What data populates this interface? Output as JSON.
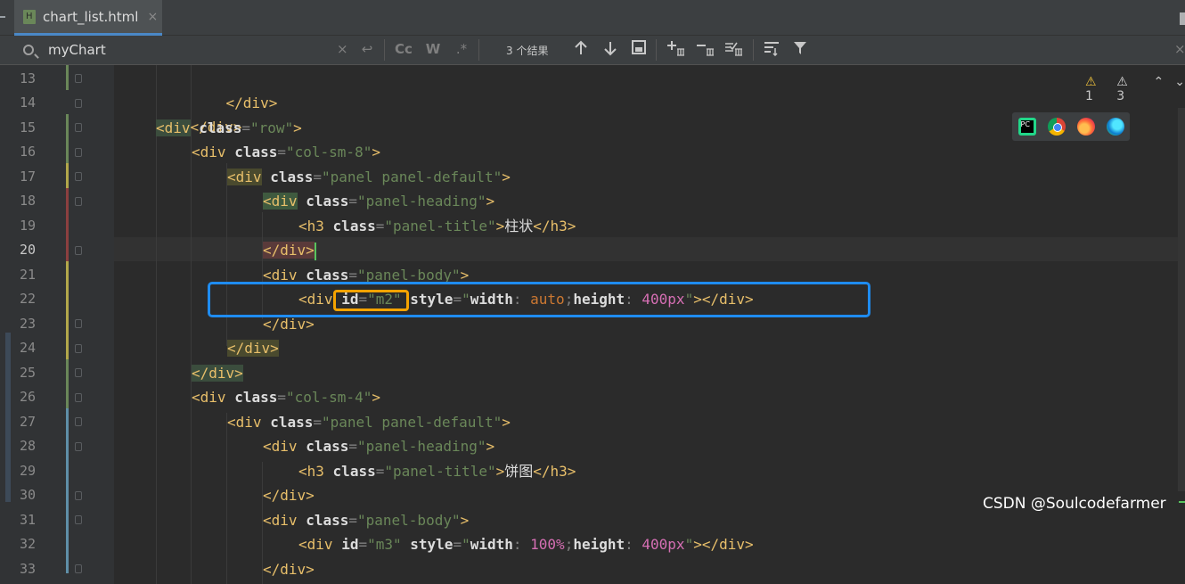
{
  "tab": {
    "filename": "chart_list.html",
    "close_symbol": "×"
  },
  "search": {
    "query": "myChart",
    "clear_symbol": "×",
    "replace_symbol": "↩",
    "match_case": "Cc",
    "whole_word": "W",
    "regex": ".*",
    "results_text": "3 个结果",
    "icons": [
      "arrow-up-icon",
      "arrow-down-icon",
      "select-all-icon",
      "add-occurrence-icon",
      "remove-occurrence-icon",
      "select-all-occurrences-icon",
      "filter-settings-icon",
      "filter-icon"
    ]
  },
  "inspections": {
    "warnings_a": "1",
    "warnings_b": "3"
  },
  "browsers": [
    "pycharm-icon",
    "chrome-icon",
    "firefox-icon",
    "edge-icon"
  ],
  "lines": [
    {
      "num": "13"
    },
    {
      "num": "14"
    },
    {
      "num": "15"
    },
    {
      "num": "16"
    },
    {
      "num": "17"
    },
    {
      "num": "18"
    },
    {
      "num": "19"
    },
    {
      "num": "20"
    },
    {
      "num": "21"
    },
    {
      "num": "22"
    },
    {
      "num": "23"
    },
    {
      "num": "24"
    },
    {
      "num": "25"
    },
    {
      "num": "26"
    },
    {
      "num": "27"
    },
    {
      "num": "28"
    },
    {
      "num": "29"
    },
    {
      "num": "30"
    },
    {
      "num": "31"
    },
    {
      "num": "32"
    },
    {
      "num": "33"
    }
  ],
  "code": {
    "l13": "</div>",
    "l14": "</div>",
    "l15_tag": "div",
    "l15_attr": "class",
    "l15_val": "\"row\"",
    "l16_tag": "div",
    "l16_attr": "class",
    "l16_val": "\"col-sm-8\"",
    "l17_tag": "div",
    "l17_attr": "class",
    "l17_val": "\"panel panel-default\"",
    "l18_tag": "div",
    "l18_attr": "class",
    "l18_val": "\"panel-heading\"",
    "l19_tag": "h3",
    "l19_attr": "class",
    "l19_val": "\"panel-title\"",
    "l19_text": "柱状",
    "l19_close": "</h3>",
    "l20": "</div>",
    "l21_tag": "div",
    "l21_attr": "class",
    "l21_val": "\"panel-body\"",
    "l22_tag": "div",
    "l22_id_attr": "id",
    "l22_id_val": "\"m2\"",
    "l22_style_attr": "style",
    "l22_style_open": "\"",
    "l22_width_prop": "width",
    "l22_width_val": "auto",
    "l22_height_prop": "height",
    "l22_height_val": "400px",
    "l22_style_close": "\"",
    "l22_close": "></div>",
    "l23": "</div>",
    "l24": "</div>",
    "l25": "</div>",
    "l26_tag": "div",
    "l26_attr": "class",
    "l26_val": "\"col-sm-4\"",
    "l27_tag": "div",
    "l27_attr": "class",
    "l27_val": "\"panel panel-default\"",
    "l28_tag": "div",
    "l28_attr": "class",
    "l28_val": "\"panel-heading\"",
    "l29_tag": "h3",
    "l29_attr": "class",
    "l29_val": "\"panel-title\"",
    "l29_text": "饼图",
    "l29_close": "</h3>",
    "l30": "</div>",
    "l31_tag": "div",
    "l31_attr": "class",
    "l31_val": "\"panel-body\"",
    "l32_tag": "div",
    "l32_id_attr": "id",
    "l32_id_val": "\"m3\"",
    "l32_style_attr": "style",
    "l32_width_prop": "width",
    "l32_width_val": "100%",
    "l32_height_prop": "height",
    "l32_height_val": "400px",
    "l32_close": "></div>",
    "l33": "</div>"
  },
  "watermark": "CSDN @Soulcodefarmer"
}
